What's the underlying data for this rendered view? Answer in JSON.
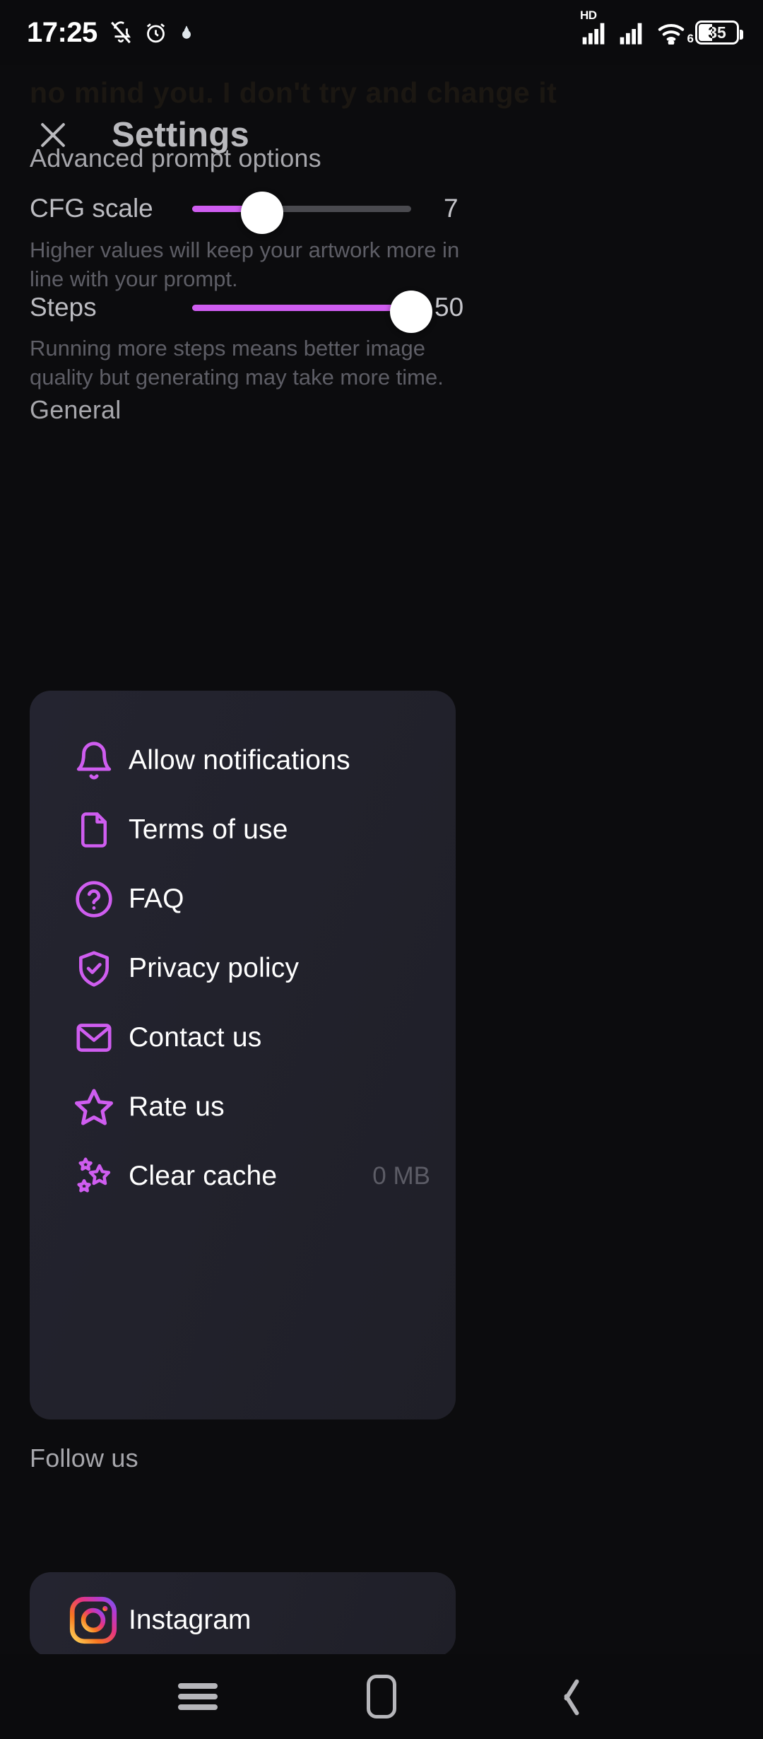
{
  "status_bar": {
    "time": "17:25",
    "battery_percent": "35",
    "wifi_generation": "6",
    "hd_label": "HD",
    "icons": [
      "bell-slash-icon",
      "alarm-clock-icon",
      "droplet-icon",
      "signal-icon",
      "signal-icon",
      "wifi-icon",
      "battery-icon"
    ]
  },
  "ghost_text": "no mind you. I don't try and change it",
  "header": {
    "title": "Settings",
    "close_label": "close-icon"
  },
  "advanced": {
    "section_title": "Advanced prompt options",
    "sliders": [
      {
        "label": "CFG scale",
        "value": "7",
        "fill_percent": 32,
        "help": "Higher values will keep your artwork more in line with your prompt."
      },
      {
        "label": "Steps",
        "value": "50",
        "fill_percent": 100,
        "help": "Running more steps means better image quality but generating may take more time."
      }
    ]
  },
  "general": {
    "section_title": "General",
    "items": [
      {
        "label": "Allow notifications",
        "icon": "bell-icon",
        "trailing": ""
      },
      {
        "label": "Terms of use",
        "icon": "document-icon",
        "trailing": ""
      },
      {
        "label": "FAQ",
        "icon": "question-circle-icon",
        "trailing": ""
      },
      {
        "label": "Privacy policy",
        "icon": "shield-check-icon",
        "trailing": ""
      },
      {
        "label": "Contact us",
        "icon": "envelope-icon",
        "trailing": ""
      },
      {
        "label": "Rate us",
        "icon": "star-icon",
        "trailing": ""
      },
      {
        "label": "Clear cache",
        "icon": "sparkles-icon",
        "trailing": "0 MB"
      }
    ]
  },
  "follow": {
    "section_title": "Follow us",
    "items": [
      {
        "label": "Instagram",
        "icon": "instagram-icon"
      }
    ]
  },
  "nav_bar": {
    "recents_label": "recents-icon",
    "home_label": "home-icon",
    "back_label": "back-icon"
  },
  "colors": {
    "accent": "#cf5df0",
    "background": "#0c0c0e",
    "card": "#22222c",
    "text_primary": "#ffffff",
    "text_secondary": "#b9b9bd",
    "text_muted": "#5e5e66"
  }
}
